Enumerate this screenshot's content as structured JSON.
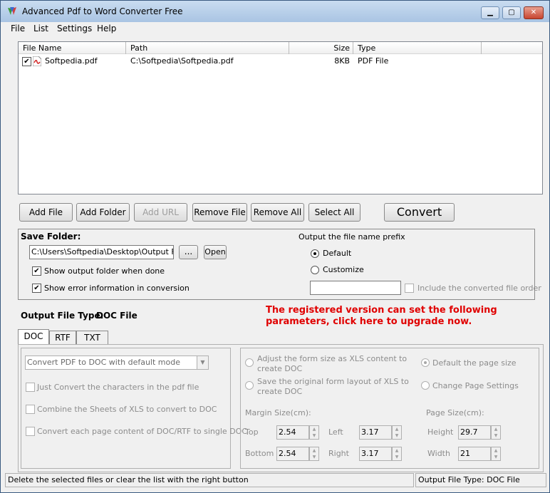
{
  "window": {
    "title": "Advanced Pdf to Word Converter Free"
  },
  "menu": [
    "File",
    "List",
    "Settings",
    "Help"
  ],
  "list": {
    "columns": [
      "File Name",
      "Path",
      "Size",
      "Type"
    ],
    "rows": [
      {
        "name": "Softpedia.pdf",
        "path": "C:\\Softpedia\\Softpedia.pdf",
        "size": "8KB",
        "type": "PDF File"
      }
    ]
  },
  "buttons": {
    "add_file": "Add File",
    "add_folder": "Add Folder",
    "add_url": "Add URL",
    "remove_file": "Remove File",
    "remove_all": "Remove All",
    "select_all": "Select All",
    "convert": "Convert"
  },
  "save": {
    "label": "Save Folder:",
    "path": "C:\\Users\\Softpedia\\Desktop\\Output Files",
    "browse": "...",
    "open": "Open",
    "show_folder": "Show output folder when done",
    "show_error": "Show error information in conversion",
    "prefix_label": "Output the file name prefix",
    "default": "Default",
    "customize": "Customize",
    "include_order": "Include the converted file order"
  },
  "output_type": {
    "label": "Output File Type:",
    "value": "DOC File"
  },
  "upgrade": {
    "line1": "The registered version can set the following",
    "line2": "parameters, click here to upgrade now."
  },
  "tabs": [
    "DOC",
    "RTF",
    "TXT"
  ],
  "doc": {
    "mode": "Convert PDF to DOC with default mode",
    "opt1": "Just Convert the characters in the pdf file",
    "opt2": "Combine the Sheets of XLS to convert to DOC",
    "opt3": "Convert each page content of DOC/RTF to single DOC"
  },
  "layout": {
    "form1a": "Adjust the form size as XLS content to",
    "form1b": "create DOC",
    "form2a": "Save the original form layout of XLS to",
    "form2b": "create DOC",
    "page_default": "Default the page size",
    "page_change": "Change Page Settings",
    "margin_label": "Margin Size(cm):",
    "page_label": "Page Size(cm):",
    "top": "Top",
    "top_val": "2.54",
    "left": "Left",
    "left_val": "3.17",
    "bottom": "Bottom",
    "bottom_val": "2.54",
    "right": "Right",
    "right_val": "3.17",
    "height": "Height",
    "height_val": "29.7",
    "width": "Width",
    "width_val": "21"
  },
  "status": {
    "left": "Delete the selected files or clear the list with the right button",
    "right_label": "Output File Type:",
    "right_value": "DOC File"
  }
}
